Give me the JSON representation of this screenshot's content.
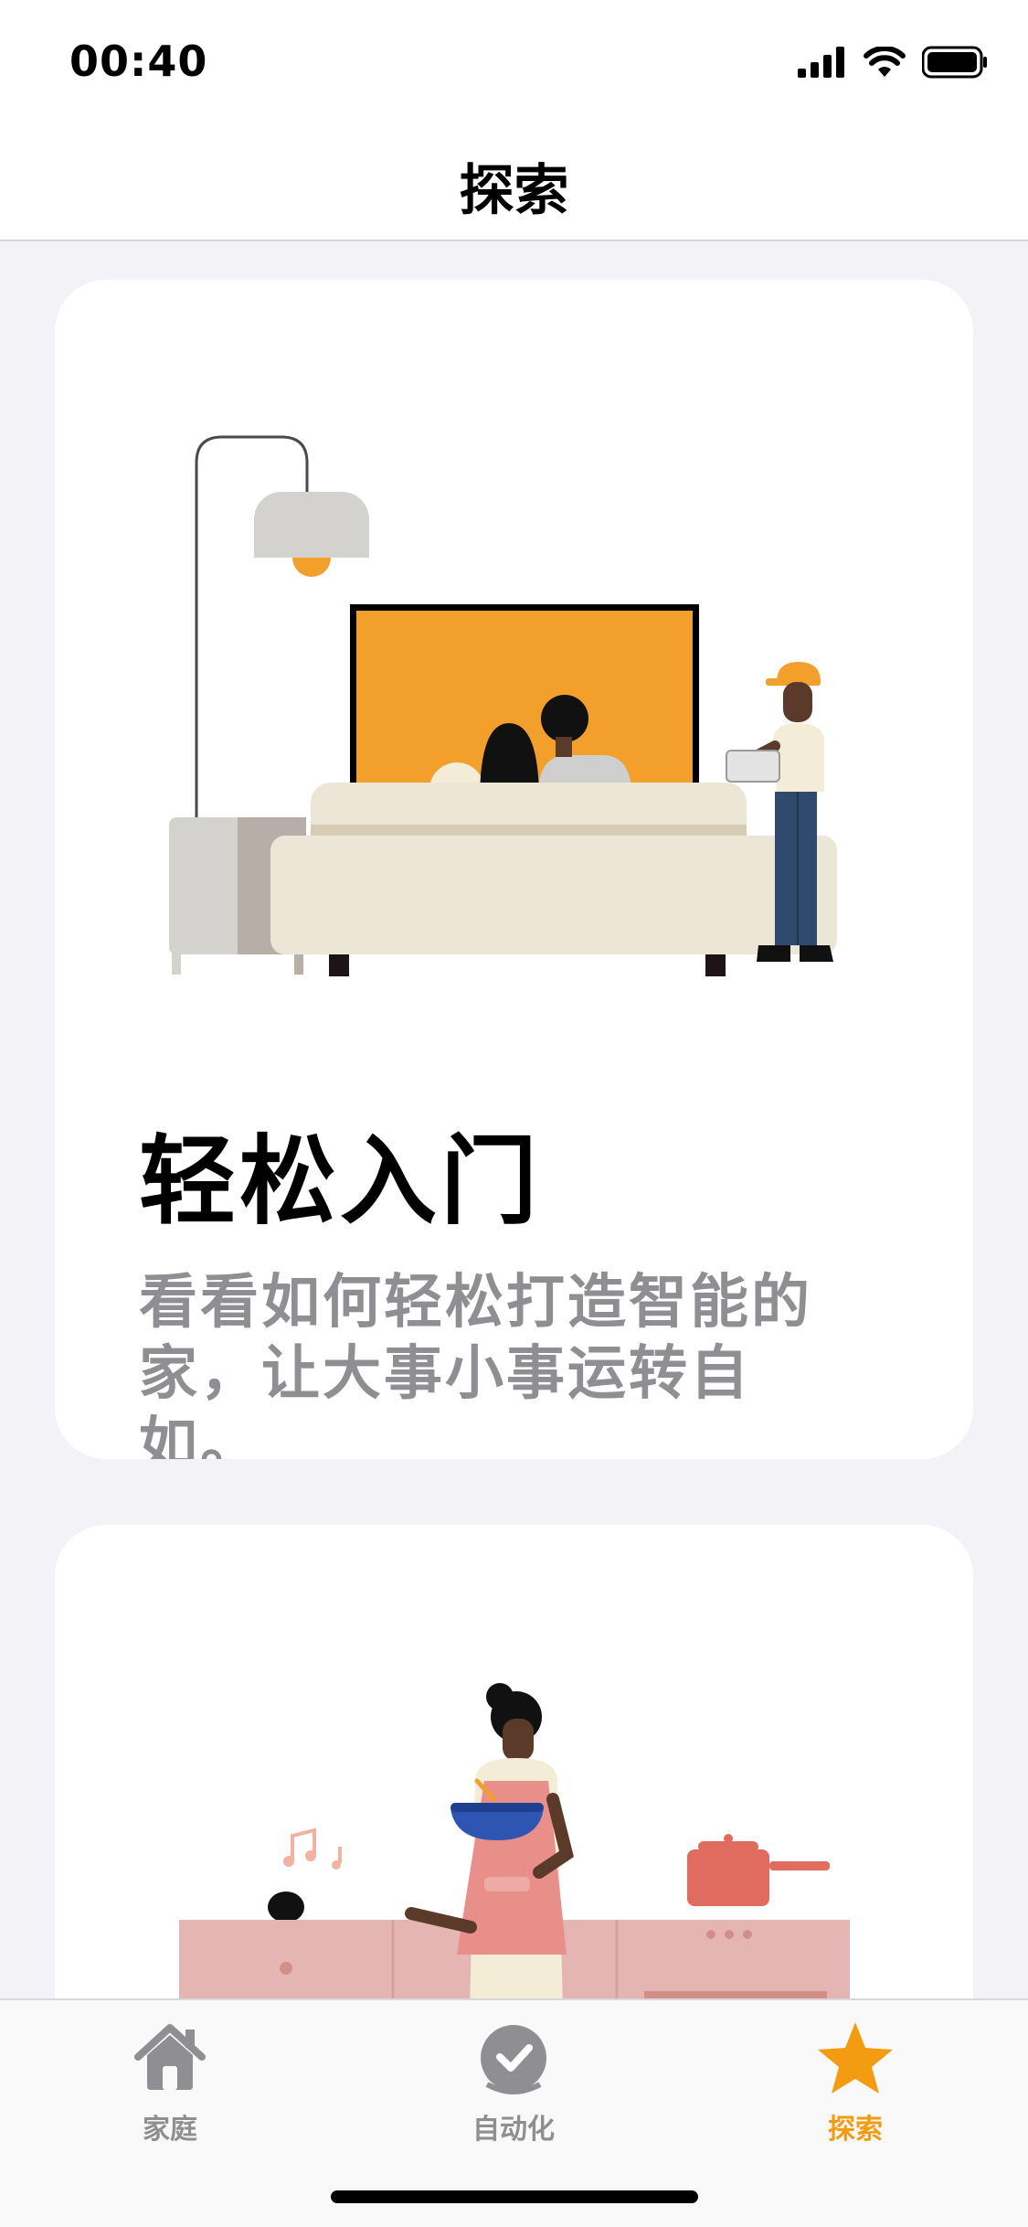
{
  "status_bar": {
    "time": "00:40",
    "icons": [
      "cellular-signal-icon",
      "wifi-icon",
      "battery-icon"
    ]
  },
  "nav": {
    "title": "探索"
  },
  "cards": [
    {
      "illustration": "living-room-illustration",
      "title": "轻松入门",
      "subtitle": "看看如何轻松打造智能的家，让大事小事运转自如。"
    },
    {
      "illustration": "kitchen-cooking-illustration"
    }
  ],
  "tab_bar": {
    "items": [
      {
        "label": "家庭",
        "icon": "house-icon",
        "selected": false
      },
      {
        "label": "自动化",
        "icon": "clock-check-icon",
        "selected": false
      },
      {
        "label": "探索",
        "icon": "star-icon",
        "selected": true
      }
    ]
  },
  "colors": {
    "accent": "#f39c12",
    "secondary_text": "#8e8e93",
    "background": "#f2f2f7"
  }
}
